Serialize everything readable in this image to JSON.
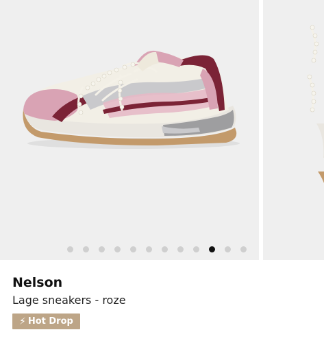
{
  "product": {
    "name": "Nelson",
    "description": "Lage sneakers - roze",
    "badge": {
      "icon": "lightning-icon",
      "label": "Hot Drop",
      "color": "#bda587"
    }
  },
  "carousel": {
    "image_count": 12,
    "active_index": 9,
    "slide_background": "#efefef",
    "dot_color": "#cfcfcf",
    "dot_active_color": "#111111"
  },
  "shoe_colors": {
    "sole_tan": "#c39a6b",
    "midsole": "#e9e6e0",
    "pink_metallic": "#d9a3b4",
    "burgundy": "#7b2336",
    "mesh_cream": "#f2efe6",
    "silver": "#c9c9cc"
  }
}
